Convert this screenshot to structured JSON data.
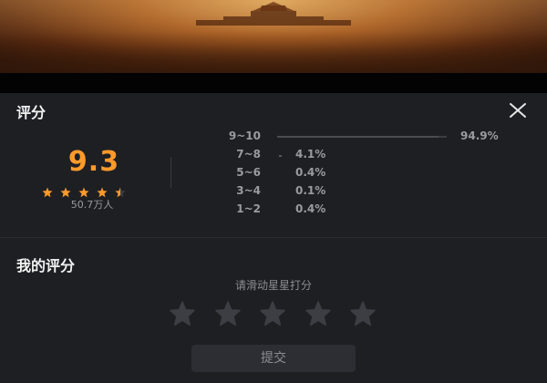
{
  "panel": {
    "title": "评分",
    "close_icon": "close-icon"
  },
  "summary": {
    "score": "9.3",
    "star_rating": 4.5,
    "stars_max": 5,
    "star_color": "#ff9a2b",
    "votes": "50.7万人"
  },
  "distribution": [
    {
      "range": "9~10",
      "percent": "94.9%",
      "fraction": 0.949
    },
    {
      "range": "7~8",
      "percent": "4.1%",
      "fraction": 0.041
    },
    {
      "range": "5~6",
      "percent": "0.4%",
      "fraction": 0.004
    },
    {
      "range": "3~4",
      "percent": "0.1%",
      "fraction": 0.001
    },
    {
      "range": "1~2",
      "percent": "0.4%",
      "fraction": 0.004
    }
  ],
  "my_rating": {
    "title": "我的评分",
    "hint": "请滑动星星打分",
    "stars_count": 5,
    "submit_label": "提交"
  },
  "colors": {
    "accent": "#ff9a2b",
    "background": "#1e1f23",
    "inactive_star": "#3c3e44"
  }
}
